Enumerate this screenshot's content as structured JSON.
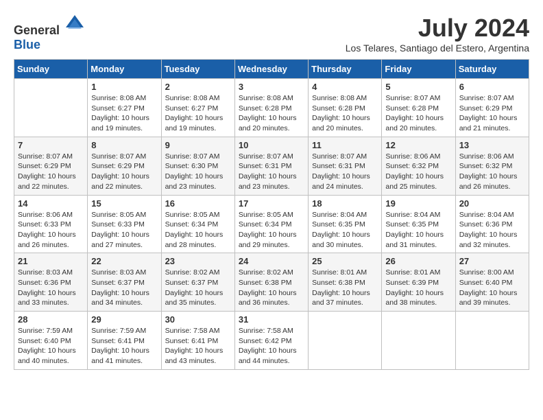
{
  "header": {
    "logo_general": "General",
    "logo_blue": "Blue",
    "month_year": "July 2024",
    "location": "Los Telares, Santiago del Estero, Argentina"
  },
  "days_of_week": [
    "Sunday",
    "Monday",
    "Tuesday",
    "Wednesday",
    "Thursday",
    "Friday",
    "Saturday"
  ],
  "weeks": [
    [
      {
        "day": "",
        "sunrise": "",
        "sunset": "",
        "daylight": ""
      },
      {
        "day": "1",
        "sunrise": "Sunrise: 8:08 AM",
        "sunset": "Sunset: 6:27 PM",
        "daylight": "Daylight: 10 hours and 19 minutes."
      },
      {
        "day": "2",
        "sunrise": "Sunrise: 8:08 AM",
        "sunset": "Sunset: 6:27 PM",
        "daylight": "Daylight: 10 hours and 19 minutes."
      },
      {
        "day": "3",
        "sunrise": "Sunrise: 8:08 AM",
        "sunset": "Sunset: 6:28 PM",
        "daylight": "Daylight: 10 hours and 20 minutes."
      },
      {
        "day": "4",
        "sunrise": "Sunrise: 8:08 AM",
        "sunset": "Sunset: 6:28 PM",
        "daylight": "Daylight: 10 hours and 20 minutes."
      },
      {
        "day": "5",
        "sunrise": "Sunrise: 8:07 AM",
        "sunset": "Sunset: 6:28 PM",
        "daylight": "Daylight: 10 hours and 20 minutes."
      },
      {
        "day": "6",
        "sunrise": "Sunrise: 8:07 AM",
        "sunset": "Sunset: 6:29 PM",
        "daylight": "Daylight: 10 hours and 21 minutes."
      }
    ],
    [
      {
        "day": "7",
        "sunrise": "Sunrise: 8:07 AM",
        "sunset": "Sunset: 6:29 PM",
        "daylight": "Daylight: 10 hours and 22 minutes."
      },
      {
        "day": "8",
        "sunrise": "Sunrise: 8:07 AM",
        "sunset": "Sunset: 6:29 PM",
        "daylight": "Daylight: 10 hours and 22 minutes."
      },
      {
        "day": "9",
        "sunrise": "Sunrise: 8:07 AM",
        "sunset": "Sunset: 6:30 PM",
        "daylight": "Daylight: 10 hours and 23 minutes."
      },
      {
        "day": "10",
        "sunrise": "Sunrise: 8:07 AM",
        "sunset": "Sunset: 6:31 PM",
        "daylight": "Daylight: 10 hours and 23 minutes."
      },
      {
        "day": "11",
        "sunrise": "Sunrise: 8:07 AM",
        "sunset": "Sunset: 6:31 PM",
        "daylight": "Daylight: 10 hours and 24 minutes."
      },
      {
        "day": "12",
        "sunrise": "Sunrise: 8:06 AM",
        "sunset": "Sunset: 6:32 PM",
        "daylight": "Daylight: 10 hours and 25 minutes."
      },
      {
        "day": "13",
        "sunrise": "Sunrise: 8:06 AM",
        "sunset": "Sunset: 6:32 PM",
        "daylight": "Daylight: 10 hours and 26 minutes."
      }
    ],
    [
      {
        "day": "14",
        "sunrise": "Sunrise: 8:06 AM",
        "sunset": "Sunset: 6:33 PM",
        "daylight": "Daylight: 10 hours and 26 minutes."
      },
      {
        "day": "15",
        "sunrise": "Sunrise: 8:05 AM",
        "sunset": "Sunset: 6:33 PM",
        "daylight": "Daylight: 10 hours and 27 minutes."
      },
      {
        "day": "16",
        "sunrise": "Sunrise: 8:05 AM",
        "sunset": "Sunset: 6:34 PM",
        "daylight": "Daylight: 10 hours and 28 minutes."
      },
      {
        "day": "17",
        "sunrise": "Sunrise: 8:05 AM",
        "sunset": "Sunset: 6:34 PM",
        "daylight": "Daylight: 10 hours and 29 minutes."
      },
      {
        "day": "18",
        "sunrise": "Sunrise: 8:04 AM",
        "sunset": "Sunset: 6:35 PM",
        "daylight": "Daylight: 10 hours and 30 minutes."
      },
      {
        "day": "19",
        "sunrise": "Sunrise: 8:04 AM",
        "sunset": "Sunset: 6:35 PM",
        "daylight": "Daylight: 10 hours and 31 minutes."
      },
      {
        "day": "20",
        "sunrise": "Sunrise: 8:04 AM",
        "sunset": "Sunset: 6:36 PM",
        "daylight": "Daylight: 10 hours and 32 minutes."
      }
    ],
    [
      {
        "day": "21",
        "sunrise": "Sunrise: 8:03 AM",
        "sunset": "Sunset: 6:36 PM",
        "daylight": "Daylight: 10 hours and 33 minutes."
      },
      {
        "day": "22",
        "sunrise": "Sunrise: 8:03 AM",
        "sunset": "Sunset: 6:37 PM",
        "daylight": "Daylight: 10 hours and 34 minutes."
      },
      {
        "day": "23",
        "sunrise": "Sunrise: 8:02 AM",
        "sunset": "Sunset: 6:37 PM",
        "daylight": "Daylight: 10 hours and 35 minutes."
      },
      {
        "day": "24",
        "sunrise": "Sunrise: 8:02 AM",
        "sunset": "Sunset: 6:38 PM",
        "daylight": "Daylight: 10 hours and 36 minutes."
      },
      {
        "day": "25",
        "sunrise": "Sunrise: 8:01 AM",
        "sunset": "Sunset: 6:38 PM",
        "daylight": "Daylight: 10 hours and 37 minutes."
      },
      {
        "day": "26",
        "sunrise": "Sunrise: 8:01 AM",
        "sunset": "Sunset: 6:39 PM",
        "daylight": "Daylight: 10 hours and 38 minutes."
      },
      {
        "day": "27",
        "sunrise": "Sunrise: 8:00 AM",
        "sunset": "Sunset: 6:40 PM",
        "daylight": "Daylight: 10 hours and 39 minutes."
      }
    ],
    [
      {
        "day": "28",
        "sunrise": "Sunrise: 7:59 AM",
        "sunset": "Sunset: 6:40 PM",
        "daylight": "Daylight: 10 hours and 40 minutes."
      },
      {
        "day": "29",
        "sunrise": "Sunrise: 7:59 AM",
        "sunset": "Sunset: 6:41 PM",
        "daylight": "Daylight: 10 hours and 41 minutes."
      },
      {
        "day": "30",
        "sunrise": "Sunrise: 7:58 AM",
        "sunset": "Sunset: 6:41 PM",
        "daylight": "Daylight: 10 hours and 43 minutes."
      },
      {
        "day": "31",
        "sunrise": "Sunrise: 7:58 AM",
        "sunset": "Sunset: 6:42 PM",
        "daylight": "Daylight: 10 hours and 44 minutes."
      },
      {
        "day": "",
        "sunrise": "",
        "sunset": "",
        "daylight": ""
      },
      {
        "day": "",
        "sunrise": "",
        "sunset": "",
        "daylight": ""
      },
      {
        "day": "",
        "sunrise": "",
        "sunset": "",
        "daylight": ""
      }
    ]
  ]
}
